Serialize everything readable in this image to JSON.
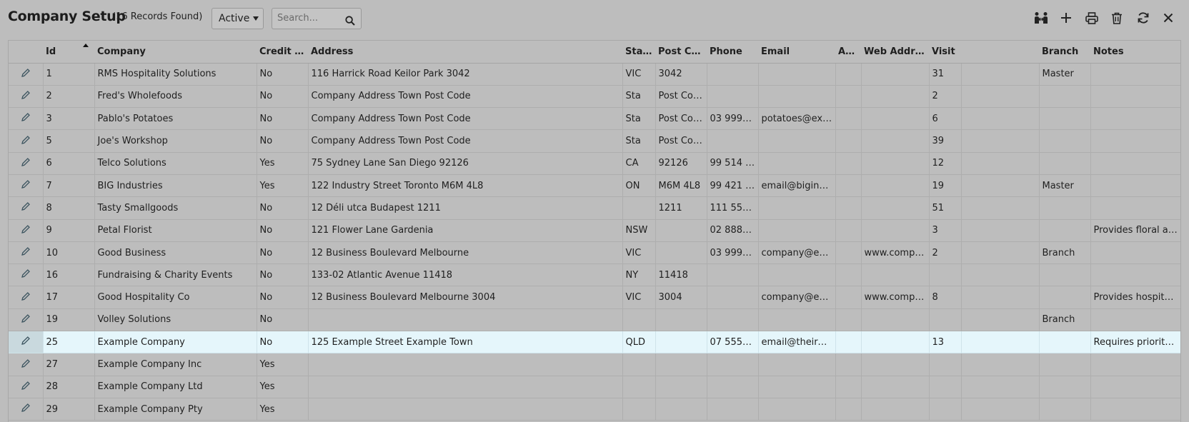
{
  "header": {
    "title": "Company Setup",
    "records": "(16 Records Found)",
    "status_filter": "Active",
    "search_placeholder": "Search..."
  },
  "toolbar": {
    "icons": [
      "link-people-icon",
      "add-icon",
      "print-icon",
      "delete-icon",
      "refresh-icon",
      "close-icon"
    ]
  },
  "table": {
    "columns": [
      "",
      "Id",
      "Company",
      "Credit H...",
      "Address",
      "State",
      "Post Cod...",
      "Phone",
      "Email",
      "AB...",
      "Web Address",
      "Visit",
      "",
      "Branch",
      "Notes"
    ],
    "sort_column": "Id",
    "sort_direction": "asc",
    "selected_row": 12,
    "rows": [
      [
        "1",
        "RMS Hospitality Solutions",
        "No",
        "116 Harrick Road Keilor Park 3042",
        "VIC",
        "3042",
        "",
        "",
        "",
        "",
        "31",
        "",
        "Master",
        ""
      ],
      [
        "2",
        "Fred's Wholefoods",
        "No",
        "Company Address Town Post Code",
        "Sta",
        "Post Code",
        "",
        "",
        "",
        "",
        "2",
        "",
        "",
        ""
      ],
      [
        "3",
        "Pablo's Potatoes",
        "No",
        "Company Address Town Post Code",
        "Sta",
        "Post Code",
        "03 9999 ...",
        "potatoes@exa...",
        "",
        "",
        "6",
        "",
        "",
        ""
      ],
      [
        "5",
        "Joe's Workshop",
        "No",
        "Company Address Town Post Code",
        "Sta",
        "Post Code",
        "",
        "",
        "",
        "",
        "39",
        "",
        "",
        ""
      ],
      [
        "6",
        "Telco Solutions",
        "Yes",
        "75 Sydney Lane San Diego 92126",
        "CA",
        "92126",
        "99 514 4...",
        "",
        "",
        "",
        "12",
        "",
        "",
        ""
      ],
      [
        "7",
        "BIG Industries",
        "Yes",
        "122 Industry Street Toronto M6M 4L8",
        "ON",
        "M6M 4L8",
        "99 421 2...",
        "email@bigindu...",
        "",
        "",
        "19",
        "",
        "Master",
        ""
      ],
      [
        "8",
        "Tasty Smallgoods",
        "No",
        "12 Déli utca Budapest 1211",
        "",
        "1211",
        "111 555 ...",
        "",
        "",
        "",
        "51",
        "",
        "",
        ""
      ],
      [
        "9",
        "Petal Florist",
        "No",
        "121 Flower Lane Gardenia",
        "NSW",
        "",
        "02 8888 ...",
        "",
        "",
        "",
        "3",
        "",
        "",
        "Provides floral arra..."
      ],
      [
        "10",
        "Good Business",
        "No",
        "12 Business Boulevard Melbourne",
        "VIC",
        "",
        "03 9999 ...",
        "company@em...",
        "",
        "www.compa...",
        "2",
        "",
        "Branch",
        ""
      ],
      [
        "16",
        "Fundraising & Charity Events",
        "No",
        "133-02 Atlantic Avenue 11418",
        "NY",
        "11418",
        "",
        "",
        "",
        "",
        "",
        "",
        "",
        ""
      ],
      [
        "17",
        "Good Hospitality Co",
        "No",
        "12 Business Boulevard Melbourne 3004",
        "VIC",
        "3004",
        "",
        "company@em...",
        "",
        "www.compa...",
        "8",
        "",
        "",
        "Provides hospitalit..."
      ],
      [
        "19",
        "Volley Solutions",
        "No",
        "",
        "",
        "",
        "",
        "",
        "",
        "",
        "",
        "",
        "Branch",
        ""
      ],
      [
        "25",
        "Example Company",
        "No",
        "125 Example Street Example Town",
        "QLD",
        "",
        "07 5550 ...",
        "email@theirdo...",
        "",
        "",
        "13",
        "",
        "",
        "Requires priority a..."
      ],
      [
        "27",
        "Example Company Inc",
        "Yes",
        "",
        "",
        "",
        "",
        "",
        "",
        "",
        "",
        "",
        "",
        ""
      ],
      [
        "28",
        "Example Company Ltd",
        "Yes",
        "",
        "",
        "",
        "",
        "",
        "",
        "",
        "",
        "",
        "",
        ""
      ],
      [
        "29",
        "Example Company Pty",
        "Yes",
        "",
        "",
        "",
        "",
        "",
        "",
        "",
        "",
        "",
        "",
        ""
      ]
    ]
  }
}
